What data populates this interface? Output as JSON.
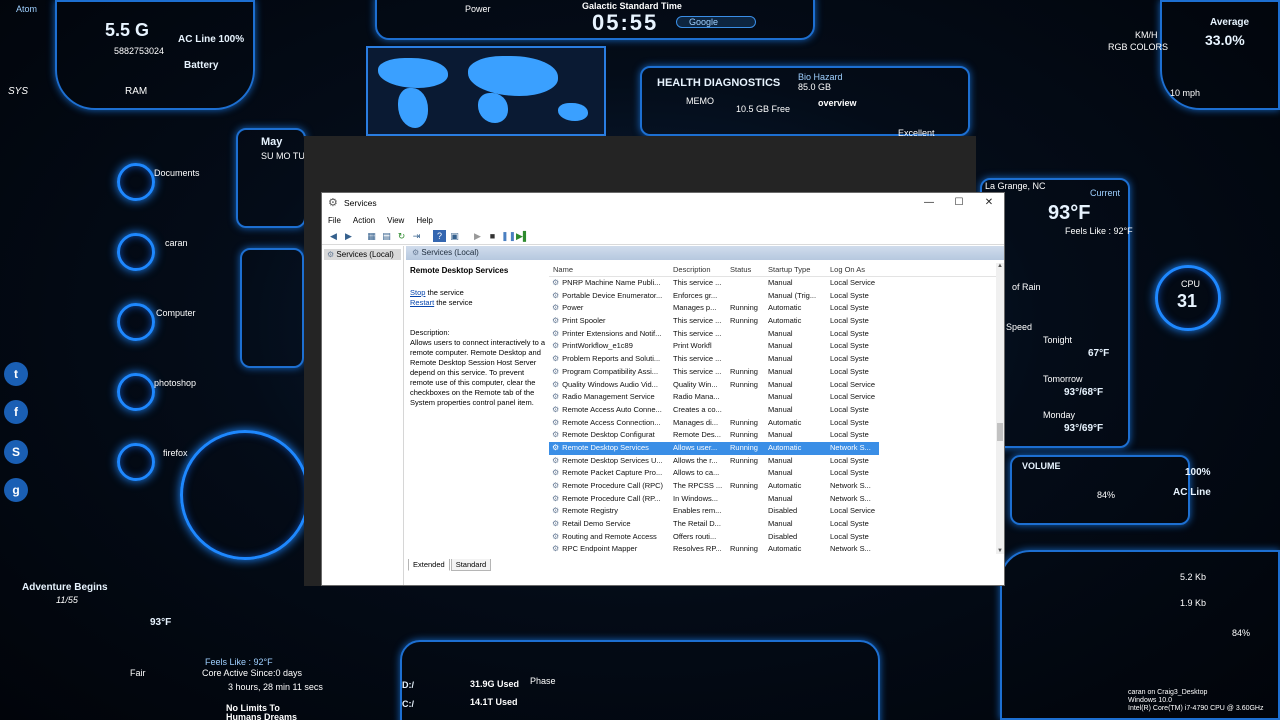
{
  "desktop": {
    "memory": {
      "value": "5.5 G",
      "id_number": "5882753024",
      "label": "RAM"
    },
    "battery": {
      "ac_line": "AC Line 100%",
      "label": "Battery"
    },
    "sys_label": "SYS",
    "atom_label": "Atom",
    "power_label": "Power",
    "clock": {
      "zone": "Galactic Standard Time",
      "time": "05:55"
    },
    "search_placeholder": "Google",
    "health": {
      "title": "HEALTH DIAGNOSTICS",
      "bio": "Bio Hazard",
      "bio_value": "85.0 GB",
      "memo": "MEMO",
      "free": "10.5 GB Free",
      "overview": "overview",
      "excellent": "Excellent"
    },
    "calendar": {
      "month": "May",
      "days": "SU MO TU"
    },
    "cpu_avg": {
      "label": "Average",
      "value": "33.0%"
    },
    "kmh": "KM/H",
    "rgb": "RGB COLORS",
    "mph": "10 mph",
    "location": "La Grange, NC",
    "weather": {
      "temp": "93°F",
      "feels": "Feels Like : 92°F",
      "current": "Current",
      "tonight": "Tonight",
      "tonight_temp": "67°F",
      "tomorrow": "Tomorrow",
      "tomorrow_temp": "93°/68°F",
      "monday": "Monday",
      "monday_temp": "93°/69°F"
    },
    "cpu_gauge": {
      "label": "CPU",
      "value": "31"
    },
    "volume": {
      "label": "VOLUME",
      "percent": "84%",
      "battery": "100%",
      "ac_line": "AC Line"
    },
    "shortcuts": [
      "Documents",
      "caran",
      "Computer",
      "photoshop",
      "firefox"
    ],
    "social_icons": [
      "t",
      "f",
      "S",
      "g"
    ],
    "adventure": {
      "title": "Adventure Begins",
      "sub": "11/55"
    },
    "bottom_weather": {
      "temp": "93°F",
      "cond": "Fair",
      "feels": "Feels Like : 92°F"
    },
    "core_active": "Core Active Since:0 days",
    "uptime": "3 hours, 28 min 11 secs",
    "quote": "No Limits To Humans Dreams",
    "drives": {
      "d": "D:/",
      "c": "C:/"
    },
    "used1": "31.9G Used",
    "used2": "14.1T Used",
    "phase": "Phase",
    "user_info": "caran on Craig3_Desktop",
    "os_info": "Windows 10.0",
    "cpu_info": "Intel(R) Core(TM) i7-4790 CPU @ 3.60GHz",
    "net": {
      "down": "5.2 Kb",
      "up": "1.9 Kb"
    },
    "disk_percent": "84%",
    "speed": "Speed",
    "rain": "of Rain"
  },
  "window": {
    "title": "Services",
    "buttons": {
      "minimize": "—",
      "maximize": "☐",
      "close": "✕"
    },
    "menu": [
      "File",
      "Action",
      "View",
      "Help"
    ],
    "tree_item": "Services (Local)",
    "pane_header": "Services (Local)",
    "detail": {
      "service_title": "Remote Desktop Services",
      "stop_link": "Stop",
      "stop_rest": " the service",
      "restart_link": "Restart",
      "restart_rest": " the service",
      "desc_label": "Description:",
      "description": "Allows users to connect interactively to a remote computer. Remote Desktop and Remote Desktop Session Host Server depend on this service. To prevent remote use of this computer, clear the checkboxes on the Remote tab of the System properties control panel item."
    },
    "columns": [
      "Name",
      "Description",
      "Status",
      "Startup Type",
      "Log On As"
    ],
    "rows": [
      [
        "PNRP Machine Name Publi...",
        "This service ...",
        "",
        "Manual",
        "Local Service"
      ],
      [
        "Portable Device Enumerator...",
        "Enforces gr...",
        "",
        "Manual (Trig...",
        "Local Syste"
      ],
      [
        "Power",
        "Manages p...",
        "Running",
        "Automatic",
        "Local Syste"
      ],
      [
        "Print Spooler",
        "This service ...",
        "Running",
        "Automatic",
        "Local Syste"
      ],
      [
        "Printer Extensions and Notif...",
        "This service ...",
        "",
        "Manual",
        "Local Syste"
      ],
      [
        "PrintWorkflow_e1c89",
        "Print Workfl",
        "",
        "Manual",
        "Local Syste"
      ],
      [
        "Problem Reports and Soluti...",
        "This service ...",
        "",
        "Manual",
        "Local Syste"
      ],
      [
        "Program Compatibility Assi...",
        "This service ...",
        "Running",
        "Manual",
        "Local Syste"
      ],
      [
        "Quality Windows Audio Vid...",
        "Quality Win...",
        "Running",
        "Manual",
        "Local Service"
      ],
      [
        "Radio Management Service",
        "Radio Mana...",
        "",
        "Manual",
        "Local Service"
      ],
      [
        "Remote Access Auto Conne...",
        "Creates a co...",
        "",
        "Manual",
        "Local Syste"
      ],
      [
        "Remote Access Connection...",
        "Manages di...",
        "Running",
        "Automatic",
        "Local Syste"
      ],
      [
        "Remote Desktop Configurat",
        "Remote Des...",
        "Running",
        "Manual",
        "Local Syste"
      ],
      [
        "Remote Desktop Services",
        "Allows user...",
        "Running",
        "Automatic",
        "Network S..."
      ],
      [
        "Remote Desktop Services U...",
        "Allows the r...",
        "Running",
        "Manual",
        "Local Syste"
      ],
      [
        "Remote Packet Capture Pro...",
        "Allows to ca...",
        "",
        "Manual",
        "Local Syste"
      ],
      [
        "Remote Procedure Call (RPC)",
        "The RPCSS ...",
        "Running",
        "Automatic",
        "Network S..."
      ],
      [
        "Remote Procedure Call (RP...",
        "In Windows...",
        "",
        "Manual",
        "Network S..."
      ],
      [
        "Remote Registry",
        "Enables rem...",
        "",
        "Disabled",
        "Local Service"
      ],
      [
        "Retail Demo Service",
        "The Retail D...",
        "",
        "Manual",
        "Local Syste"
      ],
      [
        "Routing and Remote Access",
        "Offers routi...",
        "",
        "Disabled",
        "Local Syste"
      ],
      [
        "RPC Endpoint Mapper",
        "Resolves RP...",
        "Running",
        "Automatic",
        "Network S..."
      ]
    ],
    "selected_row": 13,
    "tabs": [
      "Extended",
      "Standard"
    ],
    "colors": {
      "selection": "#3a8ee6",
      "hud_accent": "#1e88ff"
    }
  }
}
